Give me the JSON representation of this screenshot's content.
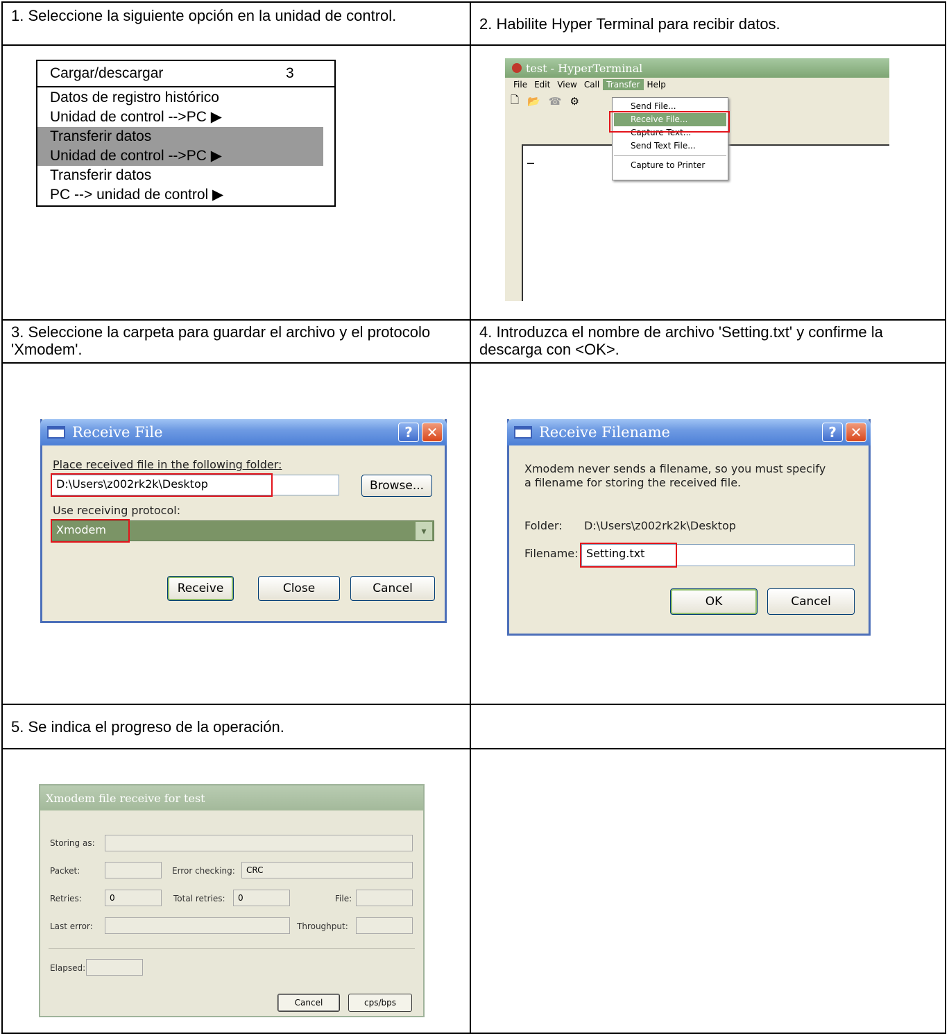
{
  "steps": {
    "s1": "1. Seleccione la siguiente opción en la unidad de control.",
    "s2": "2. Habilite Hyper Terminal para recibir datos.",
    "s3": "3. Seleccione la carpeta para guardar el archivo y el protocolo 'Xmodem'.",
    "s4": "4. Introduzca el nombre de archivo 'Setting.txt' y confirme la descarga con <OK>.",
    "s5": "5. Se indica el progreso de la operación."
  },
  "menu": {
    "title": "Cargar/descargar",
    "number": "3",
    "lines": [
      "Datos de registro histórico",
      "Unidad de control -->PC ▶",
      "Transferir datos",
      "Unidad de control -->PC ▶",
      "Transferir datos",
      "PC --> unidad de control ▶"
    ]
  },
  "hyperterminal": {
    "title": "test - HyperTerminal",
    "menus": [
      "File",
      "Edit",
      "View",
      "Call",
      "Transfer",
      "Help"
    ],
    "dropdown": [
      "Send File...",
      "Receive File...",
      "Capture Text...",
      "Send Text File...",
      "Capture to Printer"
    ],
    "cursor": "–"
  },
  "receive_file": {
    "title": "Receive File",
    "folder_label": "Place received file in the following folder:",
    "folder_value": "D:\\Users\\z002rk2k\\Desktop",
    "browse": "Browse...",
    "protocol_label": "Use receiving protocol:",
    "protocol_value": "Xmodem",
    "receive": "Receive",
    "close": "Close",
    "cancel": "Cancel",
    "help": "?",
    "x": "✕"
  },
  "receive_filename": {
    "title": "Receive Filename",
    "message": "Xmodem never sends a filename, so you must specify a filename for storing the received file.",
    "folder_label": "Folder:",
    "folder_value": "D:\\Users\\z002rk2k\\Desktop",
    "filename_label": "Filename:",
    "filename_value": "Setting.txt",
    "ok": "OK",
    "cancel": "Cancel"
  },
  "progress": {
    "title": "Xmodem file receive for test",
    "storing_as": "Storing as:",
    "packet": "Packet:",
    "error_checking": "Error checking:",
    "error_checking_value": "CRC",
    "retries": "Retries:",
    "retries_value": "0",
    "total_retries": "Total retries:",
    "total_retries_value": "0",
    "file": "File:",
    "last_error": "Last error:",
    "throughput": "Throughput:",
    "elapsed": "Elapsed:",
    "cancel": "Cancel",
    "cpsbps": "cps/bps"
  }
}
